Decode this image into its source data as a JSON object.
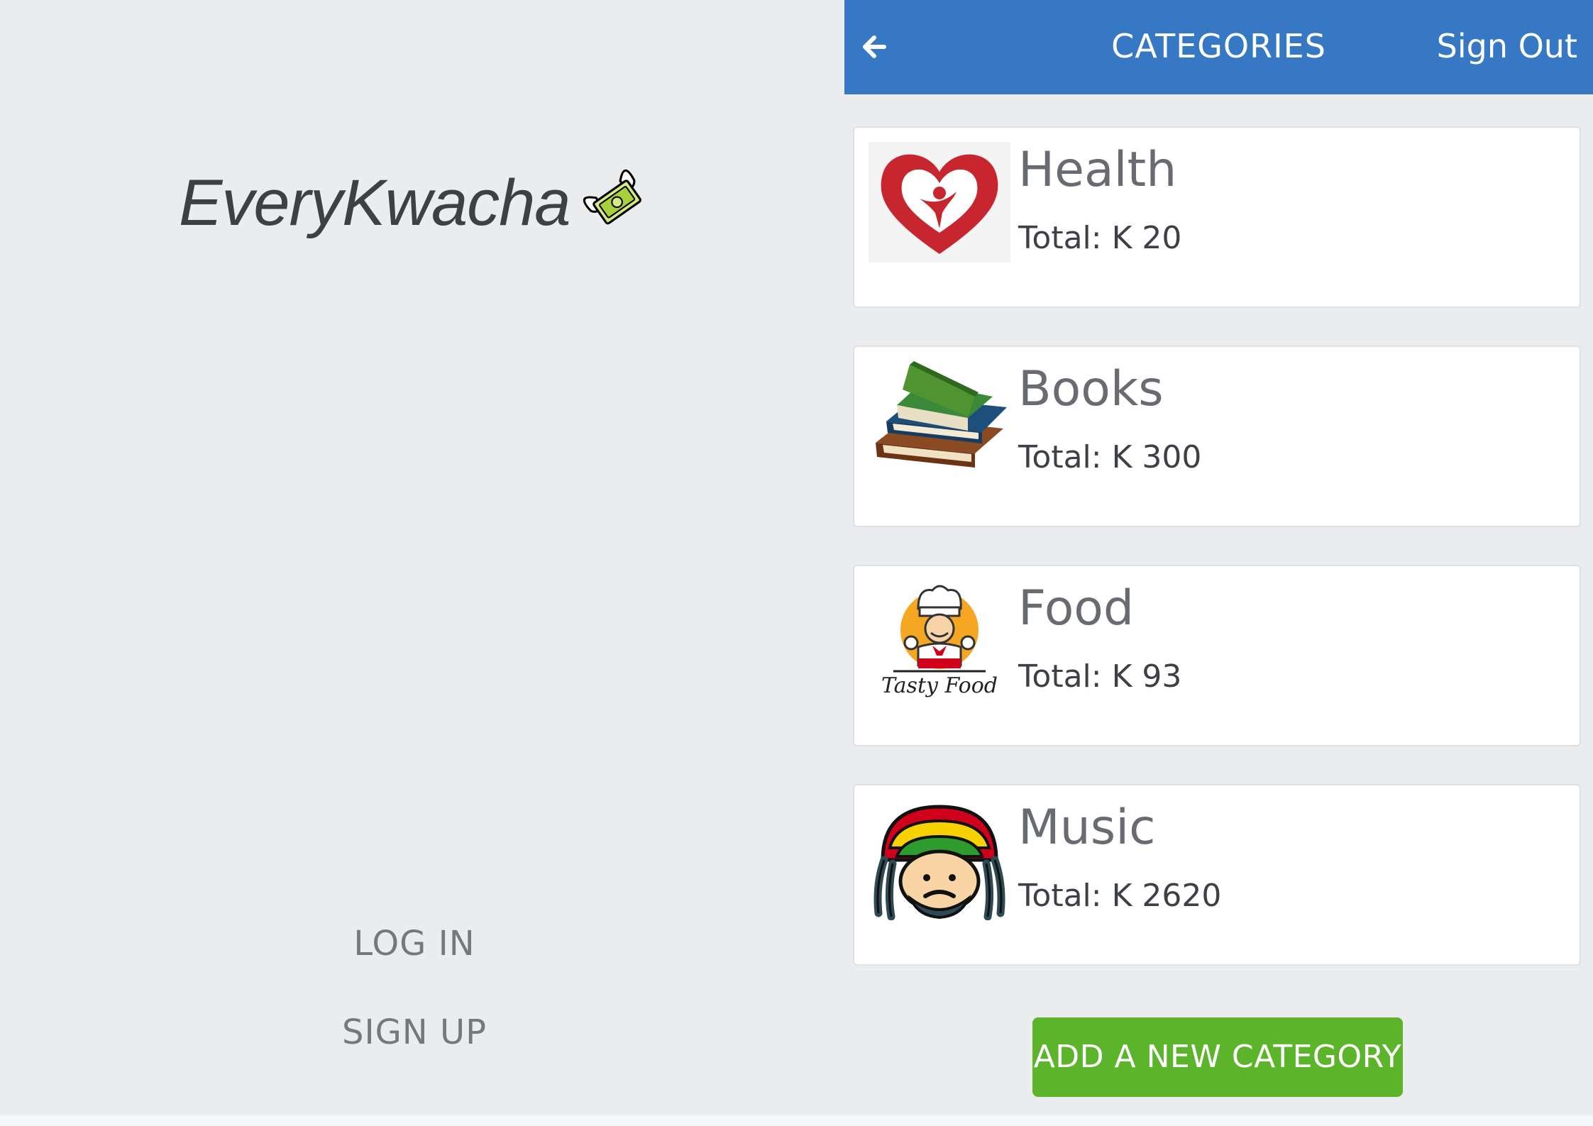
{
  "login_screen": {
    "logo_text": "EveryKwacha",
    "logo_icon": "money-wings-icon",
    "login_label": "LOG IN",
    "signup_label": "SIGN UP"
  },
  "categories_screen": {
    "header": {
      "back_icon": "arrow-left-icon",
      "title": "CATEGORIES",
      "signout_label": "Sign Out",
      "color": "#3678c4"
    },
    "categories": [
      {
        "name": "Health",
        "total": "Total: K 20",
        "icon": "heart-person-icon"
      },
      {
        "name": "Books",
        "total": "Total: K 300",
        "icon": "book-stack-icon"
      },
      {
        "name": "Food",
        "total": "Total: K 93",
        "icon": "chef-icon"
      },
      {
        "name": "Music",
        "total": "Total: K 2620",
        "icon": "rasta-face-icon"
      }
    ],
    "food_image_caption": "Tasty Food",
    "add_button_label": "ADD A NEW CATEGORY",
    "add_button_color": "#5cb42a"
  }
}
